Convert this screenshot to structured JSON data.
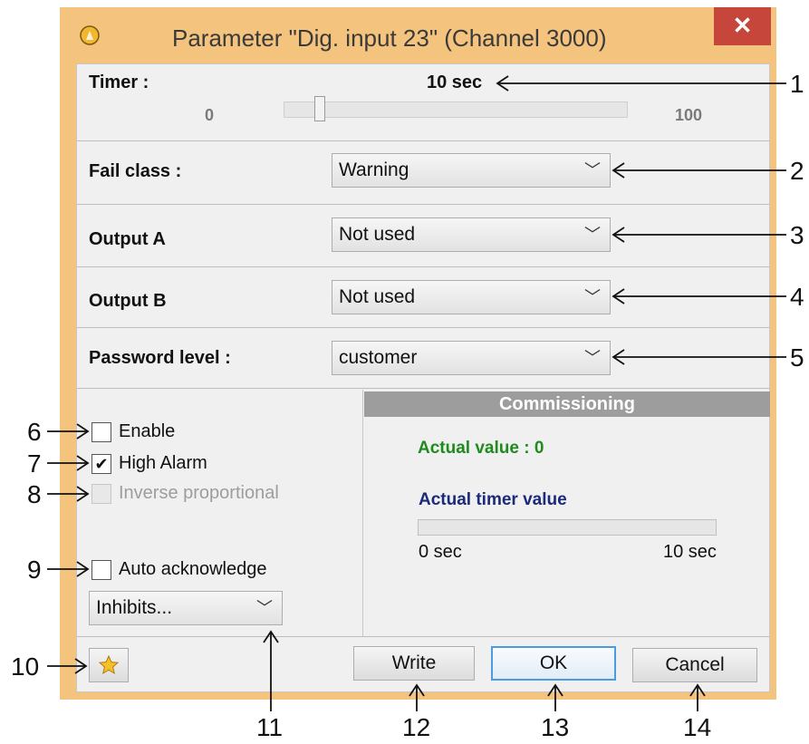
{
  "window": {
    "title": "Parameter \"Dig. input 23\" (Channel 3000)",
    "close_glyph": "✕",
    "frame_color": "#f4c37e",
    "close_color": "#c7463c"
  },
  "timer": {
    "label": "Timer :",
    "value_text": "10 sec",
    "min_label": "0",
    "max_label": "100",
    "slider_fraction": 0.1
  },
  "fields": {
    "fail_class": {
      "label": "Fail class :",
      "value": "Warning"
    },
    "output_a": {
      "label": "Output A",
      "value": "Not used"
    },
    "output_b": {
      "label": "Output B",
      "value": "Not used"
    },
    "password_level": {
      "label": "Password level :",
      "value": "customer"
    }
  },
  "checkboxes": {
    "enable": {
      "label": "Enable",
      "checked": false,
      "enabled": true
    },
    "high_alarm": {
      "label": "High Alarm",
      "checked": true,
      "enabled": true,
      "mark": "✔"
    },
    "inverse": {
      "label": "Inverse proportional",
      "checked": false,
      "enabled": false
    },
    "auto_ack": {
      "label": "Auto acknowledge",
      "checked": false,
      "enabled": true
    }
  },
  "inhibits": {
    "value": "Inhibits..."
  },
  "commissioning": {
    "header": "Commissioning",
    "actual_value": "Actual value : 0",
    "actual_timer_label": "Actual timer value",
    "timer_min": "0 sec",
    "timer_max": "10 sec",
    "timer_progress": 0,
    "actual_value_color": "#1f8b1f",
    "timer_label_color": "#1b2a7a"
  },
  "buttons": {
    "favorite_icon": "star-icon",
    "write": "Write",
    "ok": "OK",
    "cancel": "Cancel"
  },
  "callouts": [
    "1",
    "2",
    "3",
    "4",
    "5",
    "6",
    "7",
    "8",
    "9",
    "10",
    "11",
    "12",
    "13",
    "14"
  ]
}
